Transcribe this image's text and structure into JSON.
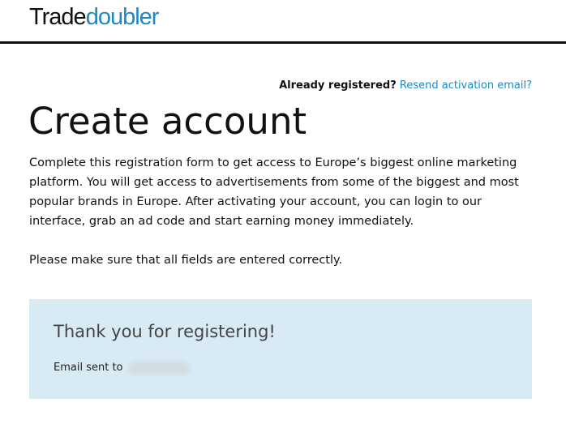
{
  "header": {
    "logo_part_a": "Trade",
    "logo_part_b": "doubler"
  },
  "login_hint": {
    "question": "Already registered?",
    "link_label": "Resend activation email?"
  },
  "page": {
    "title": "Create account",
    "intro": "Complete this registration form to get access to Europe’s biggest online marketing platform. You will get access to advertisements from some of the biggest and most popular brands in Europe. After activating your account, you can login to our interface, grab an ad code and start earning money immediately.",
    "note": "Please make sure that all fields are entered correctly."
  },
  "confirmation": {
    "title": "Thank you for registering!",
    "email_label": "Email sent to"
  },
  "colors": {
    "brand_blue": "#1a8ac6",
    "box_background": "#d8ebf5"
  }
}
